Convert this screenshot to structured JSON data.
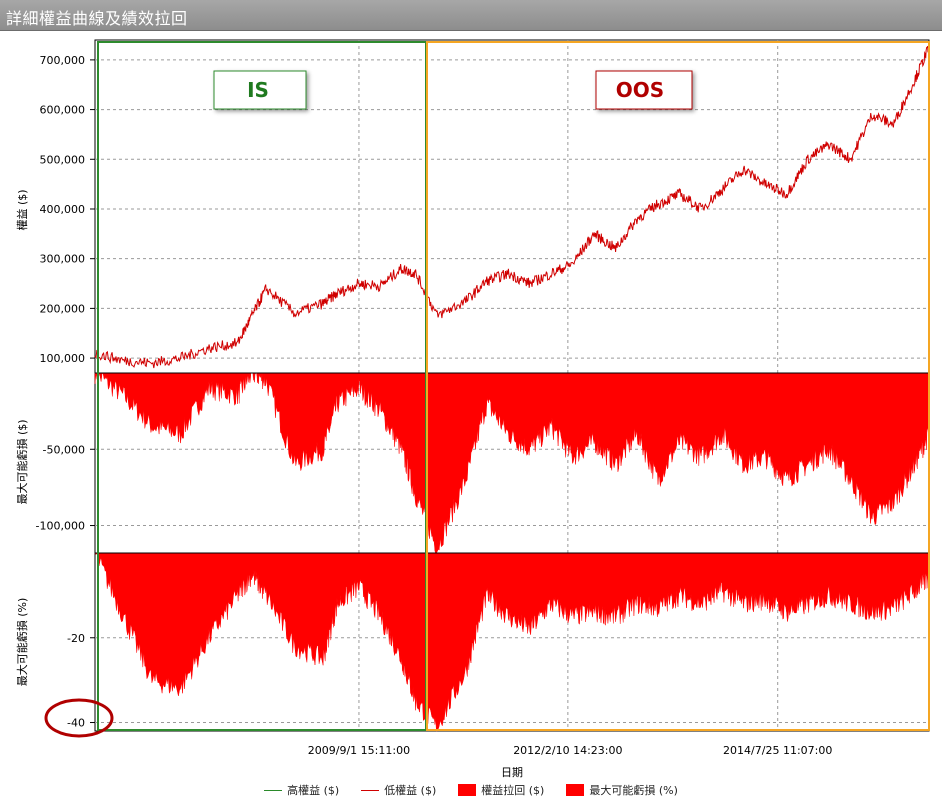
{
  "window": {
    "title": "詳細權益曲線及績效拉回"
  },
  "annotations": {
    "is_label": "IS",
    "oos_label": "OOS"
  },
  "colors": {
    "equity_line": "#d00000",
    "high_equity_line": "#2a8a2a",
    "drawdown_fill": "#ff0000",
    "is_box": "#2e8b2e",
    "oos_box": "#f5a623",
    "highlight_circle": "#b00000"
  },
  "chart_data": [
    {
      "type": "line",
      "panel": "equity",
      "ylabel": "權益 ($)",
      "ylim": [
        70000,
        740000
      ],
      "yticks": [
        100000,
        200000,
        300000,
        400000,
        500000,
        600000,
        700000
      ],
      "ytick_labels": [
        "100,000",
        "200,000",
        "300,000",
        "400,000",
        "500,000",
        "600,000",
        "700,000"
      ],
      "xlim": [
        "2006-08-01",
        "2016-05-01"
      ],
      "x": [
        "2006-08-01",
        "2006-12-01",
        "2007-04-01",
        "2007-08-01",
        "2007-12-01",
        "2008-04-01",
        "2008-06-01",
        "2008-08-01",
        "2008-12-01",
        "2009-04-01",
        "2009-06-01",
        "2009-09-01",
        "2009-12-01",
        "2010-03-01",
        "2010-05-01",
        "2010-08-01",
        "2010-12-01",
        "2011-03-01",
        "2011-06-01",
        "2011-09-01",
        "2011-12-01",
        "2012-03-01",
        "2012-06-01",
        "2012-09-01",
        "2012-12-01",
        "2013-03-01",
        "2013-06-01",
        "2013-09-01",
        "2013-12-01",
        "2014-03-01",
        "2014-06-01",
        "2014-09-01",
        "2014-12-01",
        "2015-03-01",
        "2015-06-01",
        "2015-09-01",
        "2015-12-01",
        "2016-03-01",
        "2016-05-01"
      ],
      "series": [
        {
          "values": [
            110000,
            95000,
            90000,
            100000,
            120000,
            130000,
            185000,
            240000,
            190000,
            210000,
            230000,
            250000,
            245000,
            280000,
            270000,
            185000,
            215000,
            255000,
            270000,
            250000,
            270000,
            290000,
            350000,
            320000,
            380000,
            410000,
            430000,
            400000,
            440000,
            480000,
            450000,
            430000,
            500000,
            530000,
            500000,
            590000,
            570000,
            660000,
            725000
          ]
        }
      ]
    },
    {
      "type": "area",
      "panel": "drawdown_dollar",
      "ylabel": "最大可能虧損 ($)",
      "ylim": [
        -118000,
        0
      ],
      "yticks": [
        -50000,
        -100000
      ],
      "ytick_labels": [
        "-50,000",
        "-100,000"
      ],
      "xlim": [
        "2006-08-01",
        "2016-05-01"
      ],
      "x": [
        "2006-08-01",
        "2006-12-01",
        "2007-04-01",
        "2007-08-01",
        "2007-12-01",
        "2008-04-01",
        "2008-06-01",
        "2008-08-01",
        "2008-12-01",
        "2009-04-01",
        "2009-06-01",
        "2009-09-01",
        "2009-12-01",
        "2010-03-01",
        "2010-05-01",
        "2010-08-01",
        "2010-12-01",
        "2011-03-01",
        "2011-06-01",
        "2011-09-01",
        "2011-12-01",
        "2012-03-01",
        "2012-06-01",
        "2012-09-01",
        "2012-12-01",
        "2013-03-01",
        "2013-06-01",
        "2013-09-01",
        "2013-12-01",
        "2014-03-01",
        "2014-06-01",
        "2014-09-01",
        "2014-12-01",
        "2015-03-01",
        "2015-06-01",
        "2015-09-01",
        "2015-12-01",
        "2016-03-01",
        "2016-05-01"
      ],
      "series": [
        {
          "values": [
            0,
            -15000,
            -35000,
            -40000,
            -10000,
            -15000,
            0,
            -5000,
            -60000,
            -50000,
            -20000,
            -10000,
            -25000,
            -50000,
            -80000,
            -115000,
            -70000,
            -20000,
            -40000,
            -50000,
            -35000,
            -55000,
            -45000,
            -60000,
            -40000,
            -70000,
            -45000,
            -55000,
            -40000,
            -60000,
            -55000,
            -70000,
            -60000,
            -50000,
            -70000,
            -95000,
            -85000,
            -60000,
            -40000
          ]
        }
      ]
    },
    {
      "type": "area",
      "panel": "drawdown_percent",
      "ylabel": "最大可能虧損 (%)",
      "ylim": [
        -42,
        0
      ],
      "yticks": [
        -20,
        -40
      ],
      "ytick_labels": [
        "-20",
        "-40"
      ],
      "xlim": [
        "2006-08-01",
        "2016-05-01"
      ],
      "xtick_labels": [
        "2009/9/1 15:11:00",
        "2012/2/10 14:23:00",
        "2014/7/25 11:07:00"
      ],
      "xticks": [
        "2009-09-01",
        "2012-02-10",
        "2014-07-25"
      ],
      "xlabel": "日期",
      "x": [
        "2006-08-01",
        "2006-12-01",
        "2007-04-01",
        "2007-08-01",
        "2007-12-01",
        "2008-04-01",
        "2008-06-01",
        "2008-08-01",
        "2008-12-01",
        "2009-04-01",
        "2009-06-01",
        "2009-09-01",
        "2009-12-01",
        "2010-03-01",
        "2010-05-01",
        "2010-08-01",
        "2010-12-01",
        "2011-03-01",
        "2011-06-01",
        "2011-09-01",
        "2011-12-01",
        "2012-03-01",
        "2012-06-01",
        "2012-09-01",
        "2012-12-01",
        "2013-03-01",
        "2013-06-01",
        "2013-09-01",
        "2013-12-01",
        "2014-03-01",
        "2014-06-01",
        "2014-09-01",
        "2014-12-01",
        "2015-03-01",
        "2015-06-01",
        "2015-09-01",
        "2015-12-01",
        "2016-03-01",
        "2016-05-01"
      ],
      "series": [
        {
          "values": [
            0,
            -15,
            -30,
            -32,
            -20,
            -10,
            -5,
            -10,
            -22,
            -25,
            -12,
            -8,
            -15,
            -25,
            -35,
            -41,
            -28,
            -10,
            -15,
            -18,
            -12,
            -15,
            -14,
            -15,
            -12,
            -13,
            -10,
            -12,
            -9,
            -12,
            -11,
            -14,
            -12,
            -10,
            -12,
            -14,
            -13,
            -9,
            -6
          ]
        }
      ]
    }
  ],
  "legend": {
    "items": [
      {
        "label": "高權益 ($)",
        "kind": "line",
        "color": "#2a8a2a"
      },
      {
        "label": "低權益 ($)",
        "kind": "line",
        "color": "#d00000"
      },
      {
        "label": "權益拉回 ($)",
        "kind": "box",
        "color": "#ff0000"
      },
      {
        "label": "最大可能虧損 (%)",
        "kind": "box",
        "color": "#ff0000"
      }
    ]
  }
}
